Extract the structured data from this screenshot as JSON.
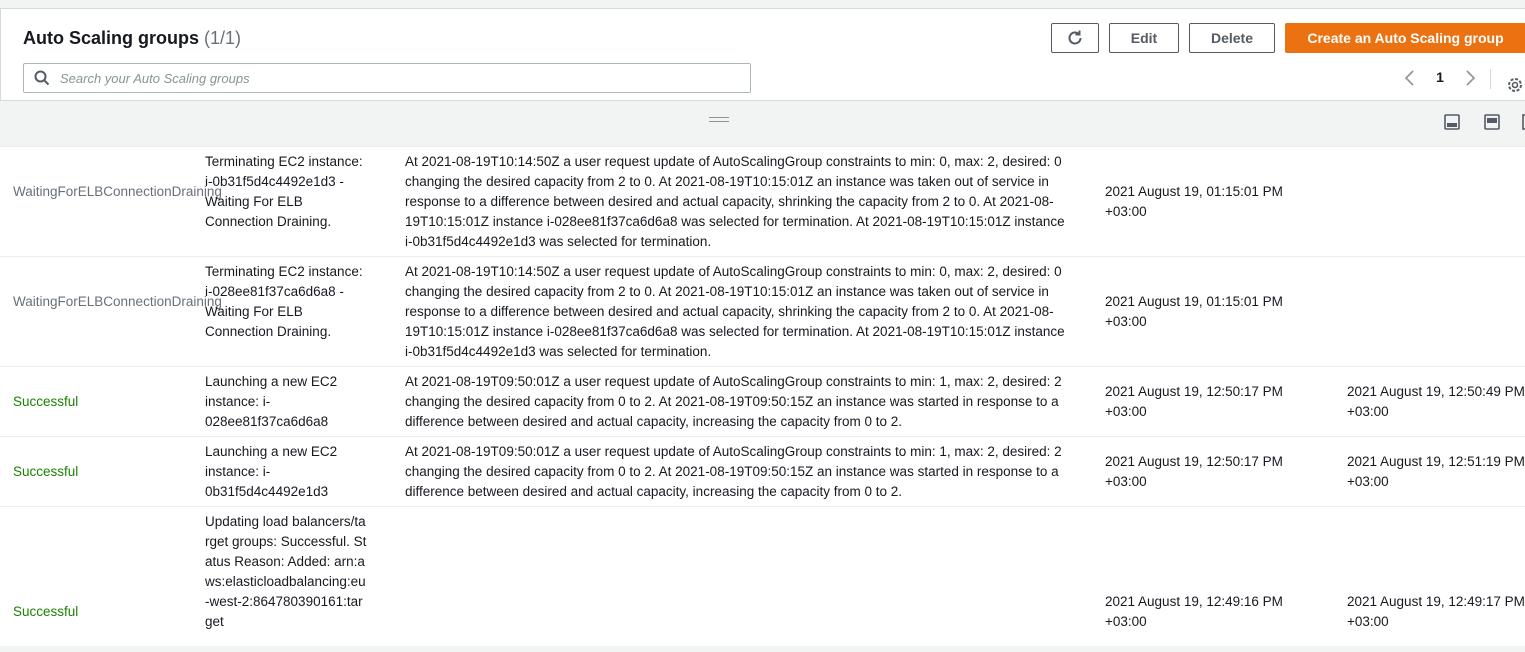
{
  "header": {
    "title": "Auto Scaling groups",
    "count": "(1/1)",
    "buttons": {
      "edit": "Edit",
      "delete": "Delete",
      "create": "Create an Auto Scaling group"
    },
    "accent_color": "#ec7211"
  },
  "search": {
    "placeholder": "Search your Auto Scaling groups",
    "value": ""
  },
  "pagination": {
    "page": "1"
  },
  "icons": {
    "refresh": "refresh-icon",
    "search": "search-icon",
    "prev": "chevron-left-icon",
    "next": "chevron-right-icon",
    "settings": "gear-icon",
    "split": "drag-handle-icon",
    "layout_bottom": "layout-bottom-icon",
    "layout_side": "layout-side-icon"
  },
  "status_colors": {
    "waiting": "#687078",
    "successful": "#1d8102"
  },
  "activity": {
    "rows": [
      {
        "status": "WaitingForELBConnectionDraining",
        "status_kind": "waiting",
        "description": "Terminating EC2 instance: i-0b31f5d4c4492e1d3 - Waiting For ELB Connection Draining.",
        "cause": "At 2021-08-19T10:14:50Z a user request update of AutoScalingGroup constraints to min: 0, max: 2, desired: 0 changing the desired capacity from 2 to 0. At 2021-08-19T10:15:01Z an instance was taken out of service in response to a difference between desired and actual capacity, shrinking the capacity from 2 to 0. At 2021-08-19T10:15:01Z instance i-028ee81f37ca6d6a8 was selected for termination. At 2021-08-19T10:15:01Z instance i-0b31f5d4c4492e1d3 was selected for termination.",
        "start_time": "2021 August 19, 01:15:01 PM +03:00",
        "end_time": ""
      },
      {
        "status": "WaitingForELBConnectionDraining",
        "status_kind": "waiting",
        "description": "Terminating EC2 instance: i-028ee81f37ca6d6a8 - Waiting For ELB Connection Draining.",
        "cause": "At 2021-08-19T10:14:50Z a user request update of AutoScalingGroup constraints to min: 0, max: 2, desired: 0 changing the desired capacity from 2 to 0. At 2021-08-19T10:15:01Z an instance was taken out of service in response to a difference between desired and actual capacity, shrinking the capacity from 2 to 0. At 2021-08-19T10:15:01Z instance i-028ee81f37ca6d6a8 was selected for termination. At 2021-08-19T10:15:01Z instance i-0b31f5d4c4492e1d3 was selected for termination.",
        "start_time": "2021 August 19, 01:15:01 PM +03:00",
        "end_time": ""
      },
      {
        "status": "Successful",
        "status_kind": "successful",
        "description": "Launching a new EC2 instance: i-028ee81f37ca6d6a8",
        "cause": "At 2021-08-19T09:50:01Z a user request update of AutoScalingGroup constraints to min: 1, max: 2, desired: 2 changing the desired capacity from 0 to 2. At 2021-08-19T09:50:15Z an instance was started in response to a difference between desired and actual capacity, increasing the capacity from 0 to 2.",
        "start_time": "2021 August 19, 12:50:17 PM +03:00",
        "end_time": "2021 August 19, 12:50:49 PM +03:00"
      },
      {
        "status": "Successful",
        "status_kind": "successful",
        "description": "Launching a new EC2 instance: i-0b31f5d4c4492e1d3",
        "cause": "At 2021-08-19T09:50:01Z a user request update of AutoScalingGroup constraints to min: 1, max: 2, desired: 2 changing the desired capacity from 0 to 2. At 2021-08-19T09:50:15Z an instance was started in response to a difference between desired and actual capacity, increasing the capacity from 0 to 2.",
        "start_time": "2021 August 19, 12:50:17 PM +03:00",
        "end_time": "2021 August 19, 12:51:19 PM +03:00"
      },
      {
        "status": "Successful",
        "status_kind": "successful",
        "description": "Updating load balancers/target groups: Successful. Status Reason: Added: arn:aws:elasticloadbalancing:eu-west-2:864780390161:target",
        "cause": "",
        "start_time": "2021 August 19, 12:49:16 PM +03:00",
        "end_time": "2021 August 19, 12:49:17 PM +03:00"
      }
    ]
  }
}
